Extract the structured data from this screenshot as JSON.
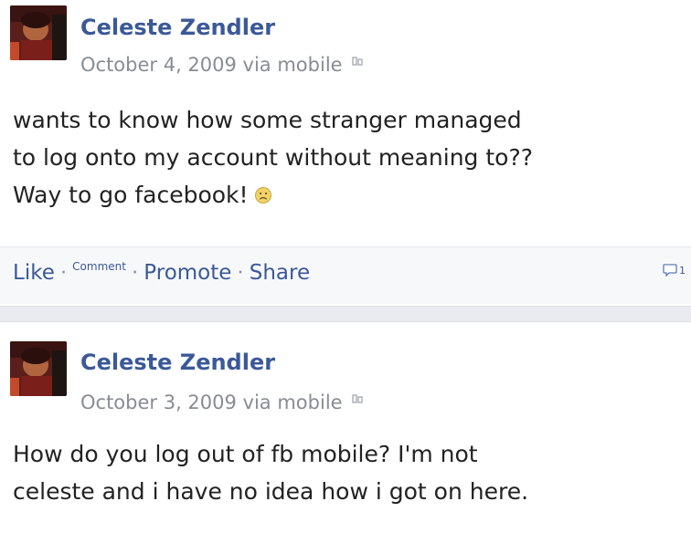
{
  "posts": [
    {
      "author": "Celeste Zendler",
      "date": "October 4, 2009 via mobile",
      "text_lines": [
        "wants to know how some stranger managed",
        "to log onto my account without meaning to??",
        "Way to go facebook!"
      ],
      "emoji": "sad-face-icon",
      "actions": {
        "like": "Like",
        "comment": "Comment",
        "promote": "Promote",
        "share": "Share",
        "separator": "·",
        "comment_count": "1"
      }
    },
    {
      "author": "Celeste Zendler",
      "date": "October 3, 2009 via mobile",
      "text_lines": [
        "How do you log out of fb mobile? I'm not",
        "celeste and i have no idea how i got on here."
      ]
    }
  ],
  "colors": {
    "link": "#3b5998",
    "meta": "#888c94",
    "text": "#222222",
    "divider": "#e9ebf0"
  }
}
